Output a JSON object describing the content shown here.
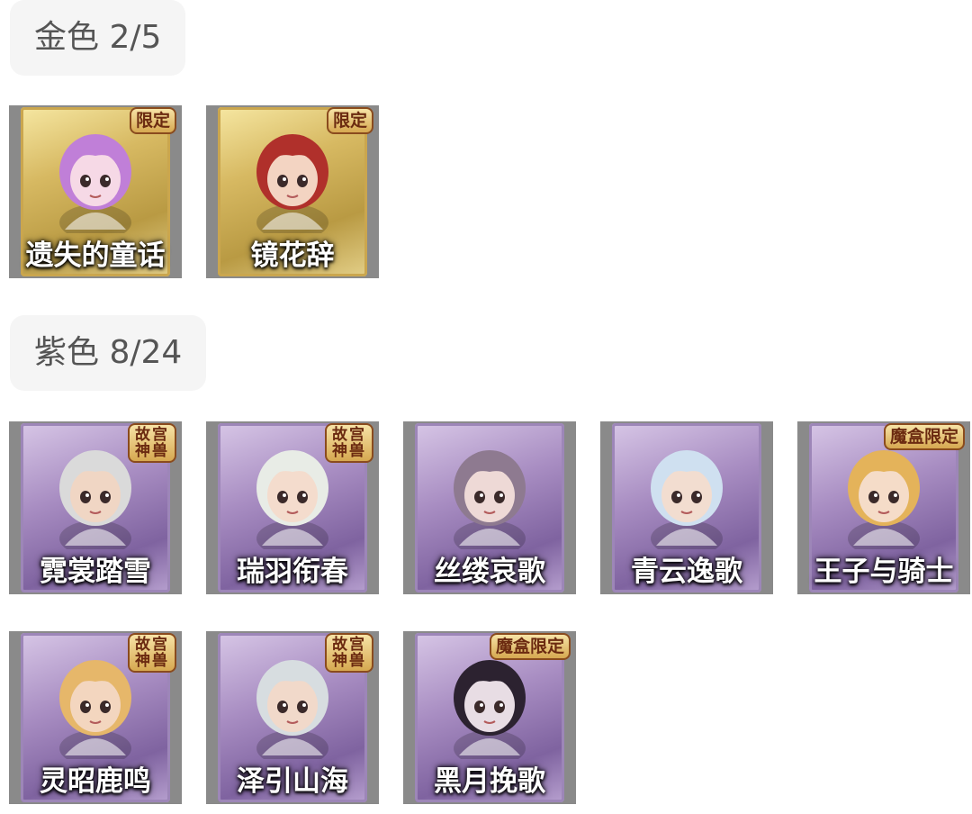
{
  "sections": {
    "gold": {
      "header": "金色 2/5",
      "items": [
        {
          "name": "遗失的童话",
          "badge": "限定",
          "hair": "#c07fd8",
          "skin": "#f6d9e6"
        },
        {
          "name": "镜花辞",
          "badge": "限定",
          "hair": "#b0302b",
          "skin": "#f3d4c2"
        }
      ]
    },
    "purple": {
      "header": "紫色 8/24",
      "items": [
        {
          "name": "霓裳踏雪",
          "badge": "故宫神兽",
          "hair": "#dadada",
          "skin": "#f0d6c4"
        },
        {
          "name": "瑞羽衔春",
          "badge": "故宫神兽",
          "hair": "#e8ece6",
          "skin": "#f4dccd"
        },
        {
          "name": "丝缕哀歌",
          "badge": "",
          "hair": "#8e7a90",
          "skin": "#eed9d6"
        },
        {
          "name": "青云逸歌",
          "badge": "",
          "hair": "#cfe0f0",
          "skin": "#f2ddd0"
        },
        {
          "name": "王子与骑士",
          "badge": "魔盒限定",
          "hair": "#e4b35a",
          "skin": "#f5dcc8"
        },
        {
          "name": "灵昭鹿鸣",
          "badge": "故宫神兽",
          "hair": "#e6b76a",
          "skin": "#f3d6bf"
        },
        {
          "name": "泽引山海",
          "badge": "故宫神兽",
          "hair": "#d7dde0",
          "skin": "#f1d9ca"
        },
        {
          "name": "黑月挽歌",
          "badge": "魔盒限定",
          "hair": "#2c2230",
          "skin": "#e8dde4"
        }
      ]
    }
  }
}
